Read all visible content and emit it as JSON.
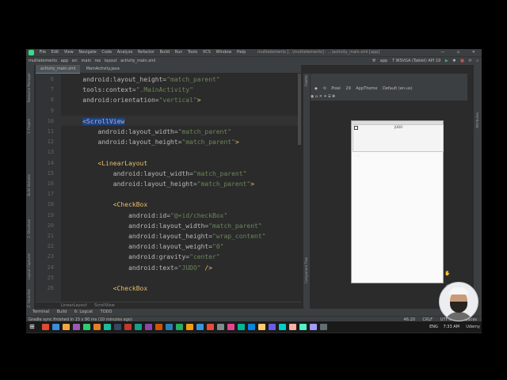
{
  "window": {
    "menu": [
      "File",
      "Edit",
      "View",
      "Navigate",
      "Code",
      "Analyze",
      "Refactor",
      "Build",
      "Run",
      "Tools",
      "VCS",
      "Window",
      "Help"
    ],
    "title": "multielements [...\\multielements] - ...\\activity_main.xml [app]"
  },
  "navbar": {
    "breadcrumbs": [
      "multielements",
      "app",
      "src",
      "main",
      "res",
      "layout",
      "activity_main.xml"
    ],
    "run_config": "app",
    "device": "7 WSVGA (Tablet) API 19"
  },
  "tabs": [
    {
      "label": "activity_main.xml",
      "active": true
    },
    {
      "label": "MainActivity.java",
      "active": false
    }
  ],
  "left_tool_labels": [
    "Resource Manager",
    "1: Project",
    "Build Variants",
    "2: Structure",
    "Layout Captures",
    "Z: Favorites"
  ],
  "code": {
    "line_numbers": [
      "6",
      "7",
      "8",
      "9",
      "10",
      "11",
      "12",
      "13",
      "14",
      "15",
      "16",
      "17",
      "18",
      "19",
      "20",
      "21",
      "22",
      "23",
      "24",
      "25",
      "26"
    ],
    "lines": [
      [
        {
          "t": "    android:layout_height=",
          "c": "attr"
        },
        {
          "t": "\"match_parent\"",
          "c": "str"
        }
      ],
      [
        {
          "t": "    tools:context=",
          "c": "attr"
        },
        {
          "t": "\".MainActivity\"",
          "c": "str"
        }
      ],
      [
        {
          "t": "    android:orientation=",
          "c": "attr"
        },
        {
          "t": "\"vertical\"",
          "c": "str"
        },
        {
          "t": ">",
          "c": "tag"
        }
      ],
      [],
      [
        {
          "t": "    ",
          "c": "attr"
        },
        {
          "t": "<ScrollView",
          "c": "sel"
        }
      ],
      [
        {
          "t": "        android:layout_width=",
          "c": "attr"
        },
        {
          "t": "\"match_parent\"",
          "c": "str"
        }
      ],
      [
        {
          "t": "        android:layout_height=",
          "c": "attr"
        },
        {
          "t": "\"match_parent\"",
          "c": "str"
        },
        {
          "t": ">",
          "c": "tag"
        }
      ],
      [],
      [
        {
          "t": "        <LinearLayout",
          "c": "tag"
        }
      ],
      [
        {
          "t": "            android:layout_width=",
          "c": "attr"
        },
        {
          "t": "\"match_parent\"",
          "c": "str"
        }
      ],
      [
        {
          "t": "            android:layout_height=",
          "c": "attr"
        },
        {
          "t": "\"match_parent\"",
          "c": "str"
        },
        {
          "t": ">",
          "c": "tag"
        }
      ],
      [],
      [
        {
          "t": "            <CheckBox",
          "c": "tag"
        }
      ],
      [
        {
          "t": "                android:id=",
          "c": "attr"
        },
        {
          "t": "\"@+id/checkBox\"",
          "c": "str"
        }
      ],
      [
        {
          "t": "                android:layout_width=",
          "c": "attr"
        },
        {
          "t": "\"match_parent\"",
          "c": "str"
        }
      ],
      [
        {
          "t": "                android:layout_height=",
          "c": "attr"
        },
        {
          "t": "\"wrap_content\"",
          "c": "str"
        }
      ],
      [
        {
          "t": "                android:layout_weight=",
          "c": "attr"
        },
        {
          "t": "\"0\"",
          "c": "str"
        }
      ],
      [
        {
          "t": "                android:gravity=",
          "c": "attr"
        },
        {
          "t": "\"center\"",
          "c": "str"
        }
      ],
      [
        {
          "t": "                android:text=",
          "c": "attr"
        },
        {
          "t": "\"JUDO\"",
          "c": "str"
        },
        {
          "t": " />",
          "c": "tag"
        }
      ],
      [],
      [
        {
          "t": "            <CheckBox",
          "c": "tag"
        }
      ]
    ]
  },
  "breadcrumb_bottom": [
    "LinearLayout",
    "ScrollView"
  ],
  "bottom_tools": [
    "Terminal",
    "Build",
    "6: Logcat",
    "TODO"
  ],
  "status": {
    "message": "Gradle sync finished in 15 s 90 ms (10 minutes ago)",
    "position": "46:20",
    "line_sep": "CRLF",
    "encoding": "UTF-8",
    "indent": "4 spaces"
  },
  "design": {
    "palette_label": "Palette",
    "component_tree_label": "Component Tree",
    "attributes_label": "Attributes",
    "device": "Pixel",
    "api": "29",
    "theme": "AppTheme",
    "locale": "Default (en-us)",
    "preview_checkbox_text": "JUDO"
  },
  "taskbar": {
    "time": "7:33 AM",
    "lang": "ENG",
    "brand": "Udemy",
    "icon_colors": [
      "#e04a2f",
      "#3c8dde",
      "#f2a93b",
      "#9b59b6",
      "#2ecc71",
      "#e67e22",
      "#1abc9c",
      "#34495e",
      "#c0392b",
      "#16a085",
      "#8e44ad",
      "#d35400",
      "#2980b9",
      "#27ae60",
      "#f39c12",
      "#3498db",
      "#e74c3c",
      "#7f8c8d",
      "#e84393",
      "#00b894",
      "#0984e3",
      "#fdcb6e",
      "#6c5ce7",
      "#00cec9",
      "#fab1a0",
      "#55efc4",
      "#a29bfe",
      "#636e72"
    ]
  }
}
